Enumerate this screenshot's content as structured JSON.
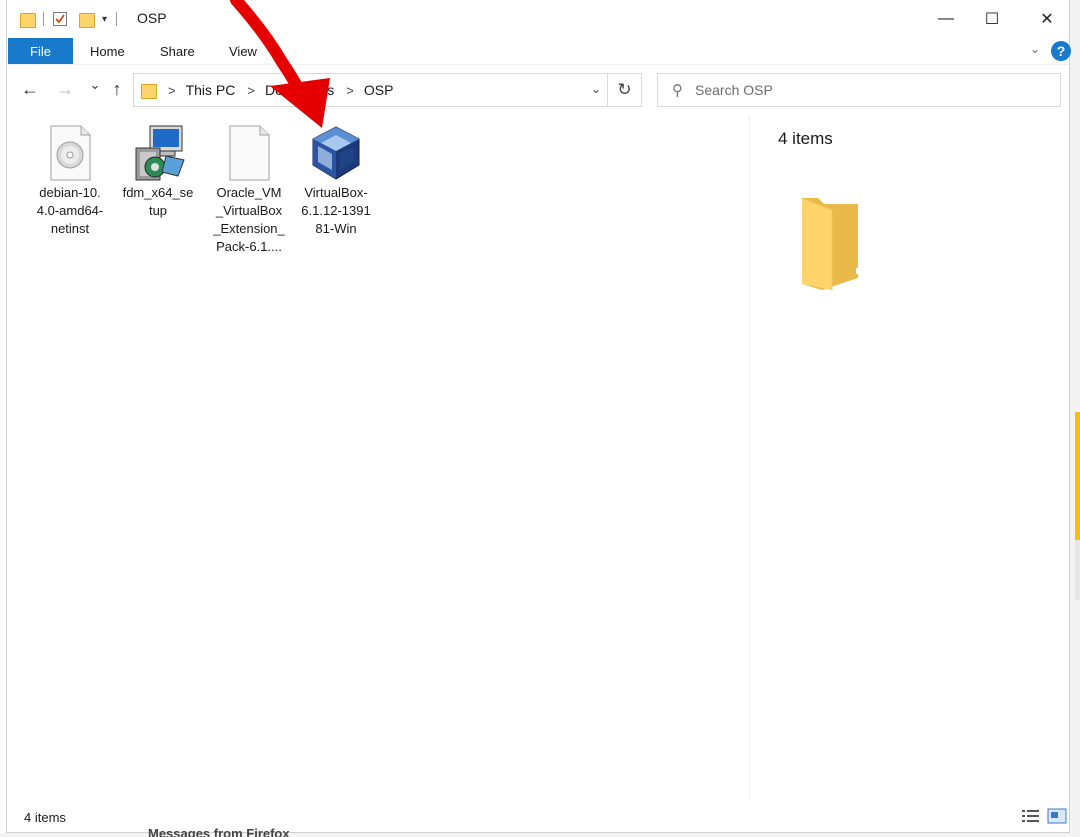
{
  "window": {
    "title": "OSP",
    "minimize": "—",
    "maximize": "☐",
    "close": "✕"
  },
  "ribbon": {
    "file": "File",
    "home": "Home",
    "share": "Share",
    "view": "View",
    "help": "?"
  },
  "nav": {
    "back": "←",
    "forward": "→",
    "recent": "⌄",
    "up": "↑",
    "breadcrumb": [
      "This PC",
      "Downloads",
      "OSP"
    ],
    "breadcrumb_sep": ">",
    "refresh": "↻"
  },
  "search": {
    "placeholder": "Search OSP"
  },
  "files": [
    {
      "name": "debian-10.\n4.0-amd64-\nnetinst",
      "icon": "disc-image-icon"
    },
    {
      "name": "fdm_x64_se\ntup",
      "icon": "installer-icon"
    },
    {
      "name": "Oracle_VM\n_VirtualBox\n_Extension_\nPack-6.1....",
      "icon": "blank-file-icon"
    },
    {
      "name": "VirtualBox-\n6.1.12-1391\n81-Win",
      "icon": "virtualbox-icon"
    }
  ],
  "preview": {
    "count": "4 items"
  },
  "status": {
    "count": "4 items"
  },
  "background": {
    "text": "Messages from Firefox"
  },
  "colors": {
    "accent": "#1979ca",
    "arrow": "#e40000",
    "folder": "#ffd56b"
  }
}
